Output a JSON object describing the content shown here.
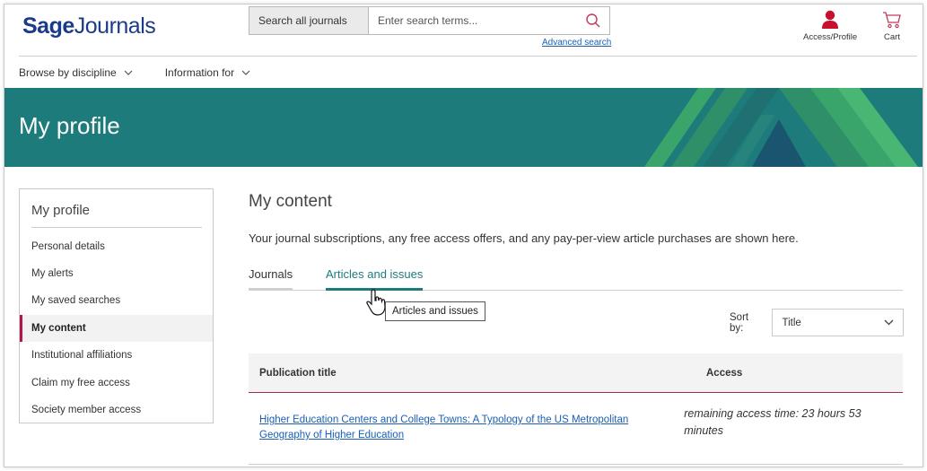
{
  "header": {
    "logo_bold": "Sage",
    "logo_light": "Journals",
    "search_scope": "Search all journals",
    "search_placeholder": "Enter search terms...",
    "advanced_search": "Advanced search",
    "access_label": "Access/Profile",
    "cart_label": "Cart"
  },
  "nav": {
    "items": [
      {
        "label": "Browse by discipline"
      },
      {
        "label": "Information for"
      }
    ]
  },
  "banner": {
    "title": "My profile",
    "color": "#1e7b7b"
  },
  "sidebar": {
    "title": "My profile",
    "items": [
      {
        "label": "Personal details"
      },
      {
        "label": "My alerts"
      },
      {
        "label": "My saved searches"
      },
      {
        "label": "My content",
        "active": true
      },
      {
        "label": "Institutional affiliations"
      },
      {
        "label": "Claim my free access"
      },
      {
        "label": "Society member access"
      }
    ]
  },
  "main": {
    "title": "My content",
    "description": "Your journal subscriptions, any free access offers, and any pay-per-view article purchases are shown here.",
    "tabs": [
      {
        "label": "Journals"
      },
      {
        "label": "Articles and issues",
        "active": true
      }
    ],
    "tooltip": "Articles and issues",
    "sort_label": "Sort by:",
    "sort_value": "Title",
    "table": {
      "headers": [
        "Publication title",
        "Access"
      ],
      "rows": [
        {
          "title": "Higher Education Centers and College Towns: A Typology of the US Metropolitan Geography of Higher Education",
          "access": "remaining access time: 23 hours 53 minutes"
        }
      ]
    }
  },
  "colors": {
    "brand": "#1a3a8a",
    "accent": "#1e7b7b",
    "active_marker": "#b0174e",
    "link": "#1a5fb4"
  }
}
